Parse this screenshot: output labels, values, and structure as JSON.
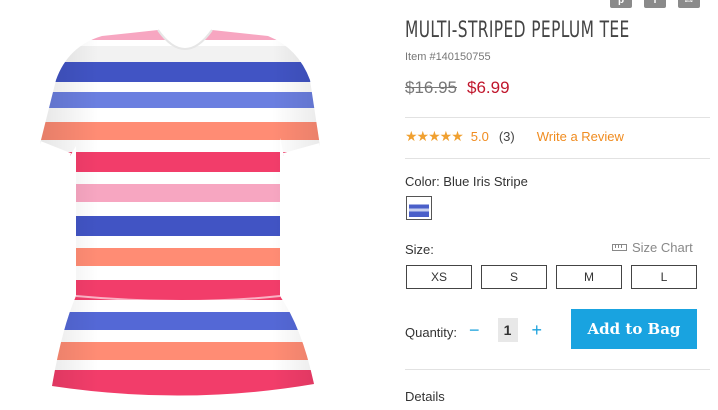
{
  "share": {
    "pinterest": "p",
    "facebook": "f",
    "email": "✉"
  },
  "product": {
    "title": "MULTI-STRIPED PEPLUM TEE",
    "item_number": "Item #140150755",
    "old_price": "$16.95",
    "new_price": "$6.99",
    "stars": "★★★★★",
    "rating": "5.0",
    "review_count": "(3)",
    "write_review": "Write a Review",
    "color_label": "Color: Blue Iris Stripe",
    "size_label": "Size:",
    "size_chart": "Size Chart",
    "sizes": [
      "XS",
      "S",
      "M",
      "L"
    ],
    "quantity_label": "Quantity:",
    "quantity_minus": "−",
    "quantity_value": "1",
    "quantity_plus": "+",
    "add_to_bag": "Add to Bag",
    "details": "Details"
  },
  "colors": {
    "accent": "#19a3e0",
    "sale": "#c0162c",
    "rating": "#f08c20"
  }
}
